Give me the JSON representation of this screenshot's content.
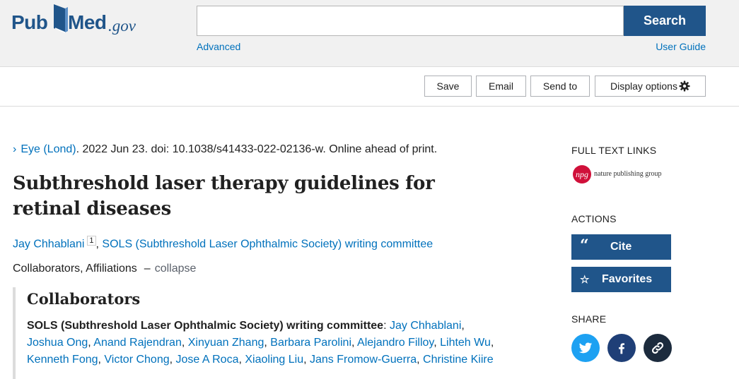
{
  "header": {
    "logo_pub": "Pub",
    "logo_med": "Med",
    "logo_gov": ".gov",
    "search_button": "Search",
    "search_placeholder": "",
    "advanced_link": "Advanced",
    "user_guide_link": "User Guide"
  },
  "toolbar": {
    "save": "Save",
    "email": "Email",
    "send_to": "Send to",
    "display_options": "Display options"
  },
  "article": {
    "journal": "Eye (Lond)",
    "citation": ". 2022 Jun 23. doi: 10.1038/s41433-022-02136-w. Online ahead of print.",
    "title": "Subthreshold laser therapy guidelines for retinal diseases",
    "authors": [
      {
        "name": "Jay Chhablani",
        "affiliation": "1"
      },
      {
        "name": "SOLS (Subthreshold Laser Ophthalmic Society) writing committee"
      }
    ],
    "collab_toggle": "Collaborators, Affiliations",
    "collapse_label": "collapse",
    "collaborators_heading": "Collaborators",
    "collaborators_group": "SOLS (Subthreshold Laser Ophthalmic Society) writing committee",
    "collaborators": [
      "Jay Chhablani",
      "Joshua Ong",
      "Anand Rajendran",
      "Xinyuan Zhang",
      "Barbara Parolini",
      "Alejandro Filloy",
      "Lihteh Wu",
      "Kenneth Fong",
      "Victor Chong",
      "Jose A Roca",
      "Xiaoling Liu",
      "Jans Fromow-Guerra",
      "Christine Kiire"
    ]
  },
  "sidebar": {
    "full_text_links": "FULL TEXT LINKS",
    "npg_mark": "npg",
    "npg_text": "nature publishing group",
    "actions": "ACTIONS",
    "cite": "Cite",
    "favorites": "Favorites",
    "share": "SHARE"
  },
  "icons": {
    "toolbar": "gear-icon",
    "journal": "chevron-right-icon",
    "cite": "quote-icon",
    "favorites": "star-icon",
    "share": [
      "twitter-icon",
      "facebook-icon",
      "link-icon"
    ]
  },
  "colors": {
    "brand_blue": "#20558a",
    "link_blue": "#0071bc",
    "twitter": "#1da1f2",
    "facebook": "#1f3f77",
    "permalink": "#1c2b3d",
    "npg_red": "#d0103a"
  }
}
